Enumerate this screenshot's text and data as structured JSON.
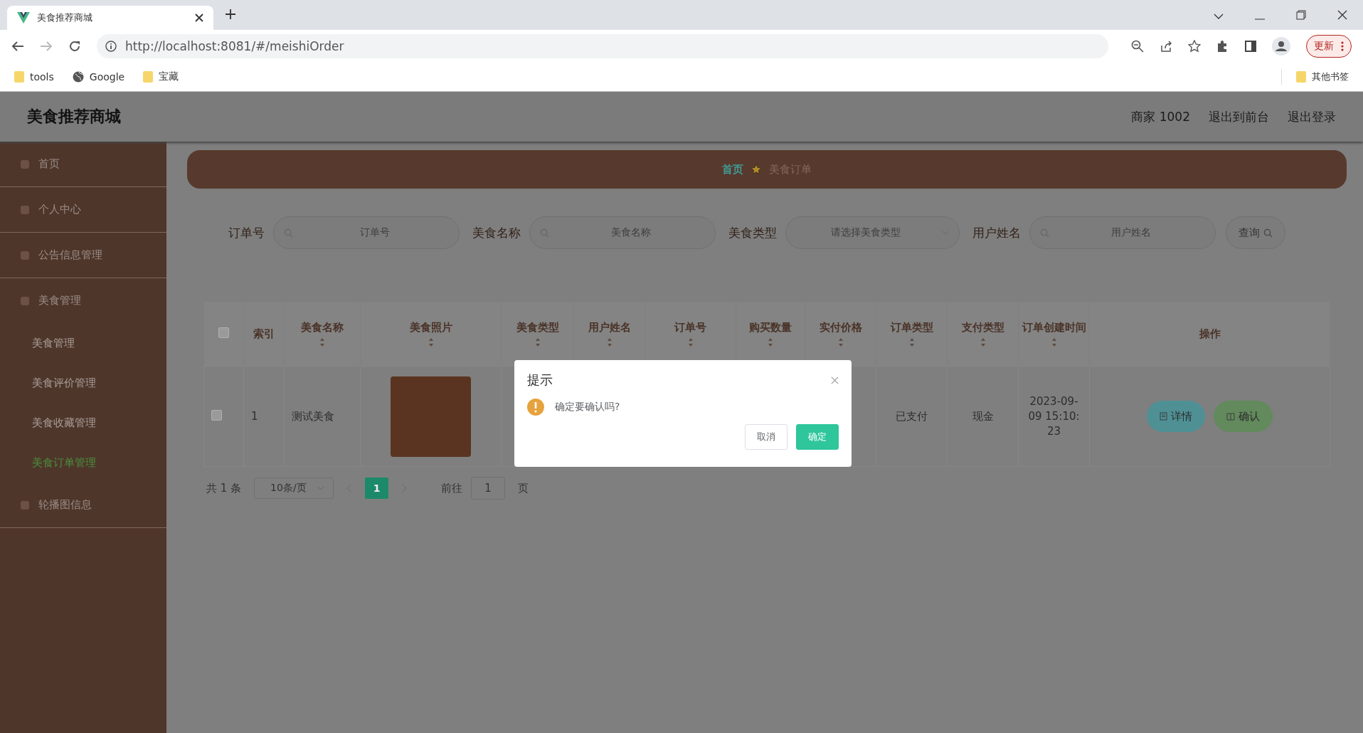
{
  "browser": {
    "tab_title": "美食推荐商城",
    "url": "http://localhost:8081/#/meishiOrder",
    "bookmarks": [
      "tools",
      "Google",
      "宝藏"
    ],
    "other_bookmarks": "其他书签",
    "update_button": "更新"
  },
  "header": {
    "title": "美食推荐商城",
    "links": [
      "商家 1002",
      "退出到前台",
      "退出登录"
    ]
  },
  "sidebar": {
    "items": [
      {
        "label": "首页",
        "selected": false
      },
      {
        "label": "个人中心",
        "selected": false
      },
      {
        "label": "公告信息管理",
        "selected": false
      },
      {
        "label": "美食管理",
        "selected": false,
        "children": [
          {
            "label": "美食管理",
            "selected": false
          },
          {
            "label": "美食评价管理",
            "selected": false
          },
          {
            "label": "美食收藏管理",
            "selected": false
          },
          {
            "label": "美食订单管理",
            "selected": true
          }
        ]
      },
      {
        "label": "轮播图信息",
        "selected": false
      }
    ]
  },
  "breadcrumb": [
    "首页",
    "美食订单"
  ],
  "search": {
    "fields": [
      {
        "label": "订单号",
        "placeholder": "订单号",
        "kind": "text"
      },
      {
        "label": "美食名称",
        "placeholder": "美食名称",
        "kind": "text"
      },
      {
        "label": "美食类型",
        "placeholder": "请选择美食类型",
        "kind": "select"
      },
      {
        "label": "用户姓名",
        "placeholder": "用户姓名",
        "kind": "text"
      }
    ],
    "button": "查询"
  },
  "table": {
    "all_checked": false,
    "columns": [
      {
        "label": "索引",
        "sortable": false
      },
      {
        "label": "美食名称",
        "sortable": true
      },
      {
        "label": "美食照片",
        "sortable": true
      },
      {
        "label": "美食类型",
        "sortable": true
      },
      {
        "label": "用户姓名",
        "sortable": true
      },
      {
        "label": "订单号",
        "sortable": true
      },
      {
        "label": "购买数量",
        "sortable": true
      },
      {
        "label": "实付价格",
        "sortable": true
      },
      {
        "label": "订单类型",
        "sortable": true
      },
      {
        "label": "支付类型",
        "sortable": true
      },
      {
        "label": "订单创建时间",
        "sortable": true
      },
      {
        "label": "操作",
        "sortable": false
      }
    ],
    "rows": [
      {
        "checked": false,
        "index": "1",
        "name": "测试美食",
        "order_type": "已支付",
        "pay_type": "现金",
        "created": "2023-09-09 15:10:23",
        "actions": [
          "详情",
          "确认"
        ]
      }
    ]
  },
  "pagination": {
    "total": "共 1 条",
    "page_size": "10条/页",
    "pages": [
      {
        "label": "1",
        "selected": true
      }
    ],
    "goto_label": "前往",
    "goto_value": "1",
    "goto_suffix": "页"
  },
  "dialog": {
    "title": "提示",
    "message": "确定要确认吗?",
    "buttons": [
      {
        "label": "取消",
        "kind": "cancel"
      },
      {
        "label": "确定",
        "kind": "primary"
      }
    ]
  }
}
